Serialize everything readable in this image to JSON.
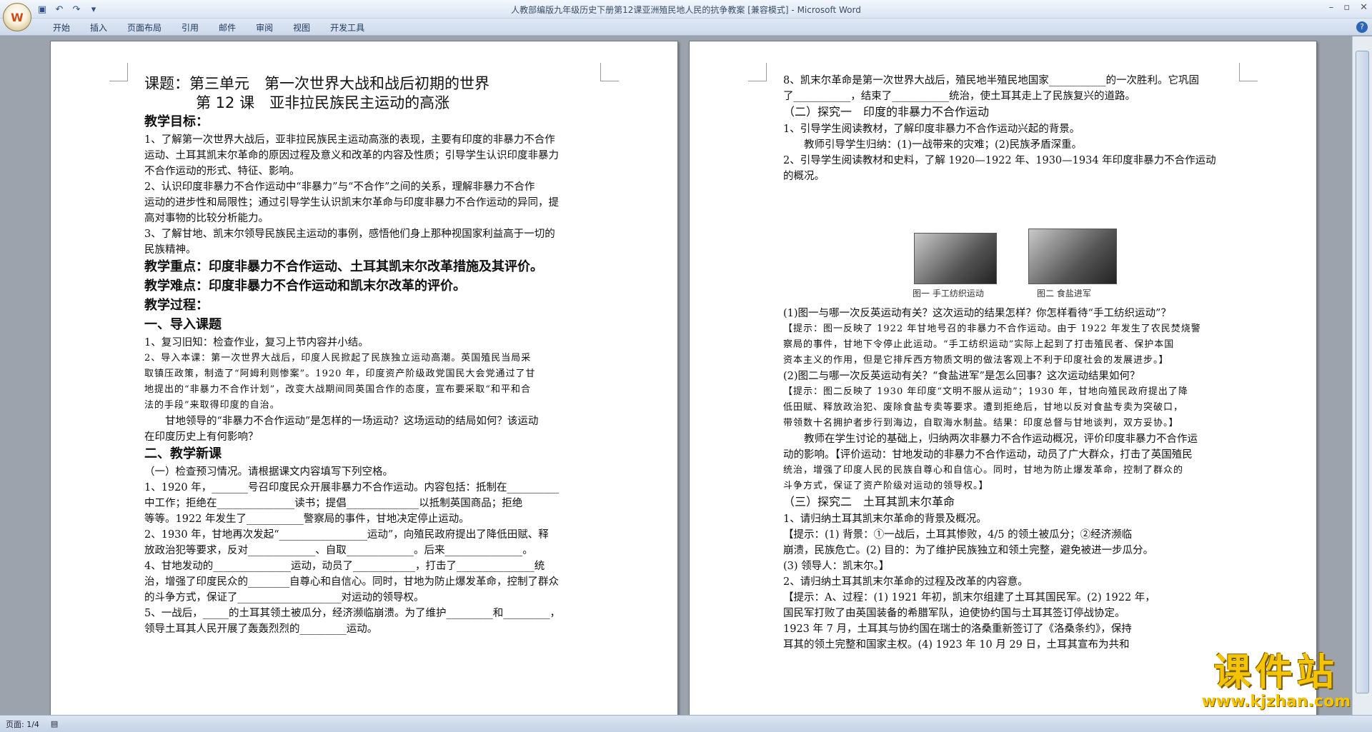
{
  "window": {
    "title": "人教部编版九年级历史下册第12课亚洲殖民地人民的抗争教案 [兼容模式] - Microsoft Word",
    "office_button": "W"
  },
  "ribbon": {
    "tabs": [
      "开始",
      "插入",
      "页面布局",
      "引用",
      "邮件",
      "审阅",
      "视图",
      "开发工具"
    ]
  },
  "status": {
    "page": "页面: 1/4"
  },
  "watermark": {
    "main": "课件站",
    "url": "www.kjzhan.com"
  },
  "page1": {
    "lines": [
      {
        "t": "课题：第三单元　第一次世界大战和战后初期的世界",
        "c": "h1"
      },
      {
        "t": "第 12 课　亚非拉民族民主运动的高涨",
        "c": "h1"
      },
      {
        "t": "教学目标：",
        "c": "h2"
      },
      {
        "t": "1、了解第一次世界大战后，亚非拉民族民主运动高涨的表现，主要有印度的非暴力不合作",
        "c": ""
      },
      {
        "t": "运动、土耳其凯末尔革命的原因过程及意义和改革的内容及性质；引导学生认识印度非暴力",
        "c": ""
      },
      {
        "t": "不合作运动的形式、特征、影响。",
        "c": ""
      },
      {
        "t": "2、认识印度非暴力不合作运动中“非暴力”与“不合作”之间的关系，理解非暴力不合作",
        "c": ""
      },
      {
        "t": "运动的进步性和局限性；通过引导学生认识凯末尔革命与印度非暴力不合作运动的异同，提",
        "c": ""
      },
      {
        "t": "高对事物的比较分析能力。",
        "c": ""
      },
      {
        "t": "3、了解甘地、凯末尔领导民族民主运动的事例，感悟他们身上那种视国家利益高于一切的",
        "c": ""
      },
      {
        "t": "民族精神。",
        "c": ""
      },
      {
        "t": "教学重点：印度非暴力不合作运动、土耳其凯末尔改革措施及其评价。",
        "c": "h2"
      },
      {
        "t": "教学难点：印度非暴力不合作运动和凯末尔改革的评价。",
        "c": "h2"
      },
      {
        "t": "教学过程：",
        "c": "h2"
      },
      {
        "t": "一、导入课题",
        "c": "h2"
      },
      {
        "t": "1、复习旧知：检查作业，复习上节内容并小结。",
        "c": ""
      },
      {
        "t": "2、导入本课：第一次世界大战后，印度人民掀起了民族独立运动高潮。英国殖民当局采",
        "c": "k"
      },
      {
        "t": "取镇压政策，制造了“阿姆利则惨案”。1920 年，印度资产阶级政党国民大会党通过了甘",
        "c": "k"
      },
      {
        "t": "地提出的“非暴力不合作计划”，改变大战期间同英国合作的态度，宣布要采取“和平和合",
        "c": "k"
      },
      {
        "t": "法的手段”来取得印度的自治。",
        "c": "k"
      },
      {
        "t": "　　甘地领导的“非暴力不合作运动”是怎样的一场运动？这场运动的结局如何？该运动",
        "c": ""
      },
      {
        "t": "在印度历史上有何影响？",
        "c": ""
      },
      {
        "t": "二、教学新课",
        "c": "h2"
      },
      {
        "t": "（一）检查预习情况。请根据课文内容填写下列空格。",
        "c": ""
      },
      {
        "t": "1、1920 年，_______号召印度民众开展非暴力不合作运动。内容包括：抵制在__________",
        "c": ""
      },
      {
        "t": "中工作；拒绝在_______________读书；提倡______________以抵制英国商品；拒绝",
        "c": ""
      },
      {
        "t": "等等。1922 年发生了___________警察局的事件，甘地决定停止运动。",
        "c": ""
      },
      {
        "t": "2、1930 年，甘地再次发起“_________________运动”，向殖民政府提出了降低田赋、释",
        "c": ""
      },
      {
        "t": "放政治犯等要求，反对_____________、自取_____________。后来_______________。",
        "c": ""
      },
      {
        "t": "4、甘地发动的_______________运动，动员了____________，打击了_______________统",
        "c": ""
      },
      {
        "t": "治，增强了印度民众的________自尊心和自信心。同时，甘地为防止爆发革命，控制了群众",
        "c": ""
      },
      {
        "t": "的斗争方式，保证了____________________对运动的领导权。",
        "c": ""
      },
      {
        "t": "5、一战后，_____的土耳其领土被瓜分，经济濒临崩溃。为了维护_________和_________，",
        "c": ""
      },
      {
        "t": "领导土耳其人民开展了轰轰烈烈的_________运动。",
        "c": ""
      }
    ]
  },
  "page2": {
    "lines": [
      {
        "t": "8、凯末尔革命是第一次世界大战后，殖民地半殖民地国家___________的一次胜利。它巩固",
        "c": ""
      },
      {
        "t": "了___________，结束了___________统治，使土耳其走上了民族复兴的道路。",
        "c": ""
      },
      {
        "t": "（二）探究一　印度的非暴力不合作运动",
        "c": "h3"
      },
      {
        "t": "1、引导学生阅读教材，了解印度非暴力不合作运动兴起的背景。",
        "c": ""
      },
      {
        "t": "　　教师引导学生归纳：(1)一战带来的灾难；(2)民族矛盾深重。",
        "c": ""
      },
      {
        "t": "2、引导学生阅读教材和史料，了解 1920—1922 年、1930—1934 年印度非暴力不合作运动",
        "c": ""
      },
      {
        "t": "的概况。",
        "c": ""
      }
    ],
    "captions": [
      "图一 手工纺织运动",
      "图二 食盐进军"
    ],
    "lines2": [
      {
        "t": "(1)图一与哪一次反英运动有关？这次运动的结果怎样？你怎样看待“手工纺织运动”？",
        "c": ""
      },
      {
        "t": "【提示：图一反映了 1922 年甘地号召的非暴力不合作运动。由于 1922 年发生了农民焚烧警",
        "c": "k"
      },
      {
        "t": "察局的事件，甘地下令停止此运动。“手工纺织运动”实际上起到了打击殖民者、保护本国",
        "c": "k"
      },
      {
        "t": "资本主义的作用，但是它排斥西方物质文明的做法客观上不利于印度社会的发展进步。】",
        "c": "k"
      },
      {
        "t": "(2)图二与哪一次反英运动有关？“食盐进军”是怎么回事？这次运动结果如何？",
        "c": ""
      },
      {
        "t": "【提示：图二反映了 1930 年印度“文明不服从运动”；1930 年，甘地向殖民政府提出了降",
        "c": "k"
      },
      {
        "t": "低田赋、释放政治犯、废除食盐专卖等要求。遭到拒绝后，甘地以反对食盐专卖为突破口，",
        "c": "k"
      },
      {
        "t": "带领数十名拥护者步行到海边，自取海水制盐。结果：印度总督与甘地谈判，双方妥协。】",
        "c": "k"
      },
      {
        "t": "　　教师在学生讨论的基础上，归纳两次非暴力不合作运动概况，评价印度非暴力不合作运",
        "c": ""
      },
      {
        "t": "动的影响。【评价运动：甘地发动的非暴力不合作运动，动员了广大群众，打击了英国殖民",
        "c": ""
      },
      {
        "t": "统治，增强了印度人民的民族自尊心和自信心。同时，甘地为防止爆发革命，控制了群众的",
        "c": "k"
      },
      {
        "t": "斗争方式，保证了资产阶级对运动的领导权。】",
        "c": "k"
      },
      {
        "t": "（三）探究二　土耳其凯末尔革命",
        "c": "h3"
      },
      {
        "t": "1、请归纳土耳其凯末尔革命的背景及概况。",
        "c": ""
      },
      {
        "t": "【提示：(1) 背景：①一战后，土耳其惨败，4/5 的领土被瓜分；②经济濒临",
        "c": ""
      },
      {
        "t": "崩溃，民族危亡。(2) 目的：为了维护民族独立和领土完整，避免被进一步瓜分。",
        "c": ""
      },
      {
        "t": "(3) 领导人：凯末尔。】",
        "c": ""
      },
      {
        "t": "2、请归纳土耳其凯末尔革命的过程及改革的内容意。",
        "c": ""
      },
      {
        "t": "【提示：A、过程：(1) 1921 年初，凯末尔组建了土耳其国民军。(2) 1922 年，",
        "c": ""
      },
      {
        "t": "国民军打败了由英国装备的希腊军队，迫使协约国与土耳其签订停战协定。",
        "c": ""
      },
      {
        "t": "1923 年 7 月，土耳其与协约国在瑞士的洛桑重新签订了《洛桑条约》，保持",
        "c": ""
      },
      {
        "t": "耳其的领土完整和国家主权。(4) 1923 年 10 月 29 日，土耳其宣布为共和",
        "c": ""
      }
    ]
  }
}
